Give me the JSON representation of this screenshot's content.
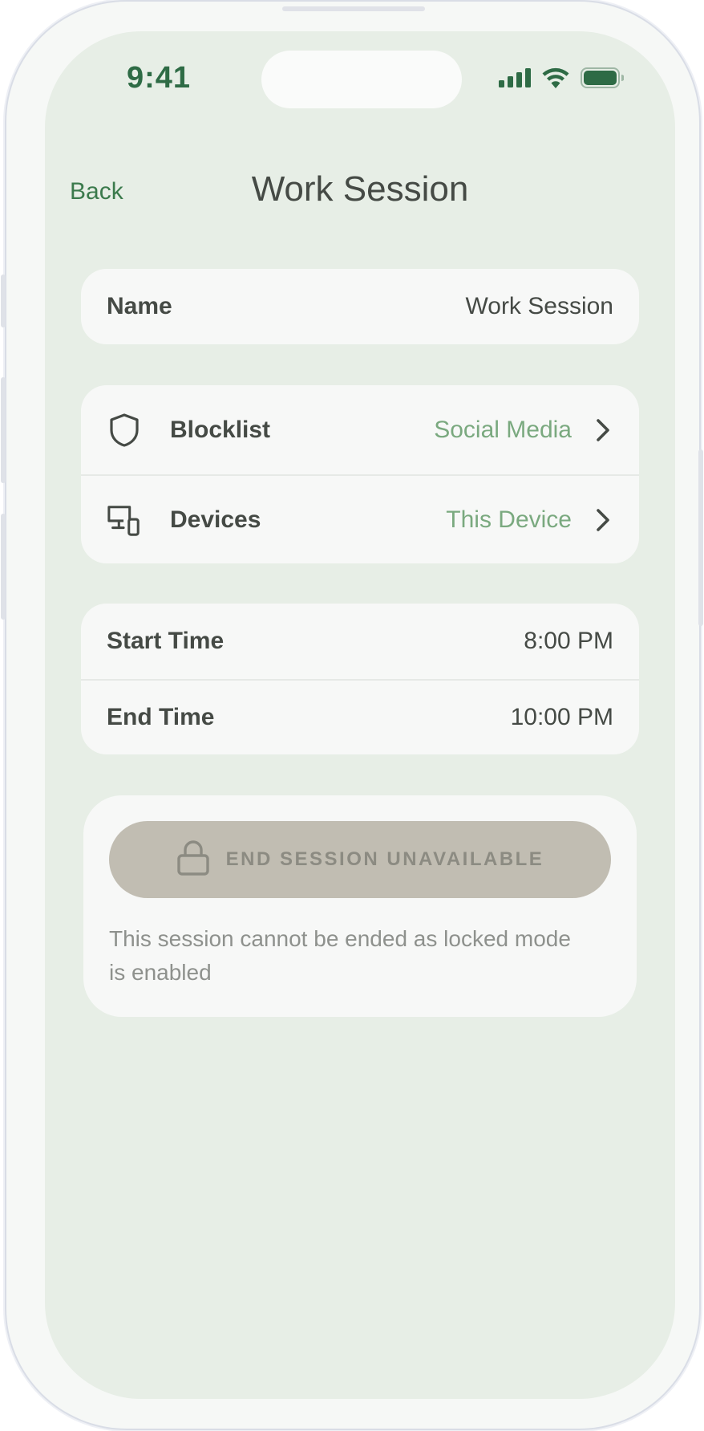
{
  "status_bar": {
    "time": "9:41",
    "signal_icon": "signal-bars-icon",
    "wifi_icon": "wifi-icon",
    "battery_icon": "battery-icon"
  },
  "nav": {
    "back_label": "Back",
    "title": "Work Session"
  },
  "name_card": {
    "label": "Name",
    "value": "Work Session"
  },
  "settings_card": {
    "blocklist": {
      "icon": "shield-icon",
      "label": "Blocklist",
      "value": "Social Media"
    },
    "devices": {
      "icon": "devices-icon",
      "label": "Devices",
      "value": "This Device"
    }
  },
  "time_card": {
    "start_label": "Start Time",
    "start_value": "8:00 PM",
    "end_label": "End Time",
    "end_value": "10:00 PM"
  },
  "end_session": {
    "icon": "lock-icon",
    "button_label": "END SESSION UNAVAILABLE",
    "note": "This session cannot be ended as locked mode is enabled"
  },
  "colors": {
    "screen_background": "#e7eee6",
    "accent_green": "#3b7a4c",
    "value_green": "#7aa97f",
    "disabled_button": "#c1bdb2"
  }
}
